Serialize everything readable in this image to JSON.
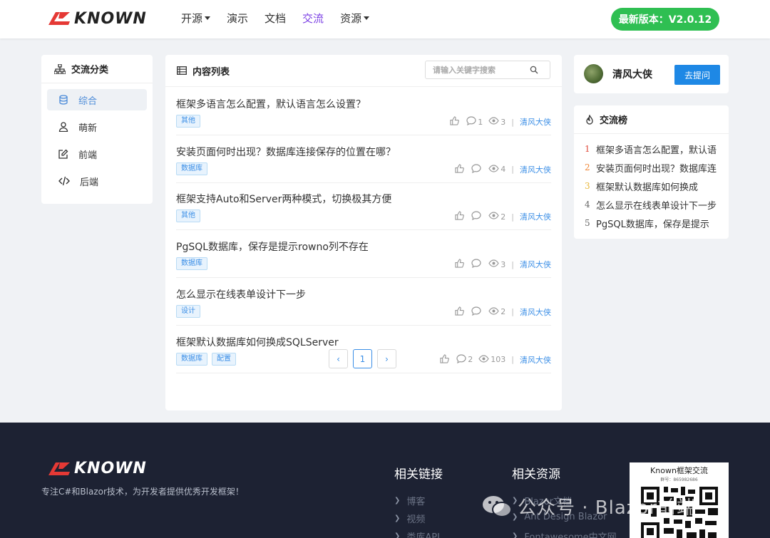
{
  "header": {
    "logo": "KNOWN",
    "nav": [
      {
        "label": "开源",
        "dropdown": true
      },
      {
        "label": "演示",
        "dropdown": false
      },
      {
        "label": "文档",
        "dropdown": false
      },
      {
        "label": "交流",
        "dropdown": false,
        "active": true
      },
      {
        "label": "资源",
        "dropdown": true
      }
    ],
    "version_label": "最新版本：V2.0.12"
  },
  "categories": {
    "title": "交流分类",
    "items": [
      {
        "label": "综合",
        "icon": "database-icon",
        "active": true
      },
      {
        "label": "萌新",
        "icon": "user-icon"
      },
      {
        "label": "前端",
        "icon": "edit-icon"
      },
      {
        "label": "后端",
        "icon": "code-icon"
      }
    ]
  },
  "content": {
    "title": "内容列表",
    "search_placeholder": "请输入关键字搜索",
    "posts": [
      {
        "title": "框架多语言怎么配置，默认语言怎么设置？",
        "tags": [
          "其他"
        ],
        "likes": "",
        "comments": "1",
        "views": "3",
        "author": "清风大侠"
      },
      {
        "title": "安装页面何时出现？数据库连接保存的位置在哪？",
        "tags": [
          "数据库"
        ],
        "likes": "",
        "comments": "",
        "views": "4",
        "author": "清风大侠"
      },
      {
        "title": "框架支持Auto和Server两种模式，切换极其方便",
        "tags": [
          "其他"
        ],
        "likes": "",
        "comments": "",
        "views": "2",
        "author": "清风大侠"
      },
      {
        "title": "PgSQL数据库，保存是提示rowno列不存在",
        "tags": [
          "数据库"
        ],
        "likes": "",
        "comments": "",
        "views": "3",
        "author": "清风大侠"
      },
      {
        "title": "怎么显示在线表单设计下一步",
        "tags": [
          "设计"
        ],
        "likes": "",
        "comments": "",
        "views": "2",
        "author": "清风大侠"
      },
      {
        "title": "框架默认数据库如何换成SQLServer",
        "tags": [
          "数据库",
          "配置"
        ],
        "likes": "",
        "comments": "2",
        "views": "103",
        "author": "清风大侠"
      }
    ],
    "pager": {
      "prev": "‹",
      "current": "1",
      "next": "›"
    }
  },
  "user": {
    "name": "清风大侠",
    "ask_label": "去提问"
  },
  "ranking": {
    "title": "交流榜",
    "items": [
      {
        "no": "1",
        "label": "框架多语言怎么配置，默认语",
        "color": "#e04a3a"
      },
      {
        "no": "2",
        "label": "安装页面何时出现？数据库连",
        "color": "#f0883a"
      },
      {
        "no": "3",
        "label": "框架默认数据库如何换成",
        "color": "#e8b73a"
      },
      {
        "no": "4",
        "label": "怎么显示在线表单设计下一步",
        "color": "#666666"
      },
      {
        "no": "5",
        "label": "PgSQL数据库，保存是提示",
        "color": "#666666"
      }
    ]
  },
  "footer": {
    "logo": "KNOWN",
    "desc": "专注C#和Blazor技术，为开发者提供优秀开发框架！",
    "links_title": "相关链接",
    "links": [
      "博客",
      "视频",
      "类库API"
    ],
    "resources_title": "相关资源",
    "resources": [
      "Blazor文档",
      "Ant Design Blazor",
      "Fontawesome中文网"
    ],
    "qr_title": "Known框架交流",
    "qr_sub": "群号：865982686",
    "watermark": "公众号 · Blazor前端"
  }
}
